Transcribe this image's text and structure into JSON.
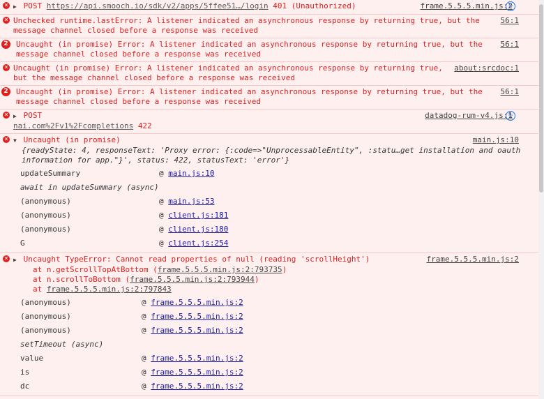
{
  "messages": {
    "m1": {
      "method": "POST",
      "url": "https://api.smooch.io/sdk/v2/apps/5ffee51…/login",
      "status": "401 (Unauthorized)",
      "source": "frame.5.5.5.min.js:2"
    },
    "m2": {
      "text_line1": "Unchecked runtime.lastError: A listener indicated an asynchronous response by returning true, but the",
      "text_line2": "message channel closed before a response was received",
      "source": "56:1"
    },
    "m3": {
      "count": "2",
      "text_line1": "Uncaught (in promise) Error: A listener indicated an asynchronous response by returning true, but the",
      "text_line2": "message channel closed before a response was received",
      "source": "56:1"
    },
    "m4": {
      "text_line1": "Uncaught (in promise) Error: A listener indicated an asynchronous response by returning true,",
      "text_line2": "but the message channel closed before a response was received",
      "source": "about:srcdoc:1"
    },
    "m5": {
      "count": "2",
      "text_line1": "Uncaught (in promise) Error: A listener indicated an asynchronous response by returning true, but the",
      "text_line2": "message channel closed before a response was received",
      "source": "56:1"
    },
    "m6": {
      "method": "POST",
      "url_tail": "nai.com%2Fv1%2Fcompletions",
      "status": "422",
      "source": "datadog-rum-v4.js:1"
    },
    "m7": {
      "title": "Uncaught (in promise)",
      "source": "main.js:10",
      "obj_line1": "{readyState: 4, responseText: 'Proxy error: {:code=>\"UnprocessableEntity\", :statu…get installation and oauth",
      "obj_line2": "information for app.\"}', status: 422, statusText: 'error'}",
      "stack": [
        {
          "fn": "updateSummary",
          "loc": "main.js:10",
          "async": false
        },
        {
          "fn": "await in updateSummary (async)",
          "loc": "",
          "async": true
        },
        {
          "fn": "(anonymous)",
          "loc": "main.js:53",
          "async": false
        },
        {
          "fn": "(anonymous)",
          "loc": "client.js:181",
          "async": false
        },
        {
          "fn": "(anonymous)",
          "loc": "client.js:180",
          "async": false
        },
        {
          "fn": "G",
          "loc": "client.js:254",
          "async": false
        }
      ]
    },
    "m8": {
      "title": "Uncaught TypeError: Cannot read properties of null (reading 'scrollHeight')",
      "source": "frame.5.5.5.min.js:2",
      "trace": [
        {
          "prefix": "at n.getScrollTopAtBottom (",
          "link": "frame.5.5.5.min.js:2:793735",
          "suffix": ")"
        },
        {
          "prefix": "at n.scrollToBottom (",
          "link": "frame.5.5.5.min.js:2:793944",
          "suffix": ")"
        },
        {
          "prefix": "at ",
          "link": "frame.5.5.5.min.js:2:797843",
          "suffix": ""
        }
      ],
      "stack": [
        {
          "fn": "(anonymous)",
          "loc": "frame.5.5.5.min.js:2",
          "async": false
        },
        {
          "fn": "(anonymous)",
          "loc": "frame.5.5.5.min.js:2",
          "async": false
        },
        {
          "fn": "(anonymous)",
          "loc": "frame.5.5.5.min.js:2",
          "async": false
        },
        {
          "fn": "setTimeout (async)",
          "loc": "",
          "async": true
        },
        {
          "fn": "value",
          "loc": "frame.5.5.5.min.js:2",
          "async": false
        },
        {
          "fn": "is",
          "loc": "frame.5.5.5.min.js:2",
          "async": false
        },
        {
          "fn": "dc",
          "loc": "frame.5.5.5.min.js:2",
          "async": false
        }
      ]
    }
  },
  "icons": {
    "error": "error-icon",
    "expand": "expand-triangle-icon",
    "network": "network-request-icon"
  },
  "symbols": {
    "at": "@",
    "expand": "▶",
    "expanded": "▼",
    "error": "✕",
    "nav": "↻"
  },
  "colors": {
    "error_text": "#e0201f",
    "error_bg": "#fff0f0",
    "link": "#1a1aa6"
  }
}
